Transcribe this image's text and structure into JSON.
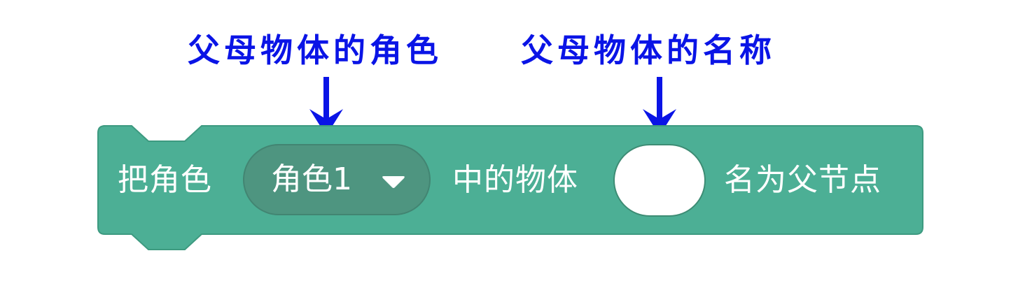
{
  "annotations": {
    "left": "父母物体的角色",
    "right": "父母物体的名称",
    "color": "#0000ff"
  },
  "block": {
    "color": "#4caf95",
    "border_color": "#3d9a80",
    "prefix": "把角色",
    "sprite_dropdown": {
      "selected": "角色1",
      "icon": "chevron-down-icon"
    },
    "middle": "中的物体",
    "object_name_input": {
      "value": ""
    },
    "suffix": "名为父节点"
  }
}
